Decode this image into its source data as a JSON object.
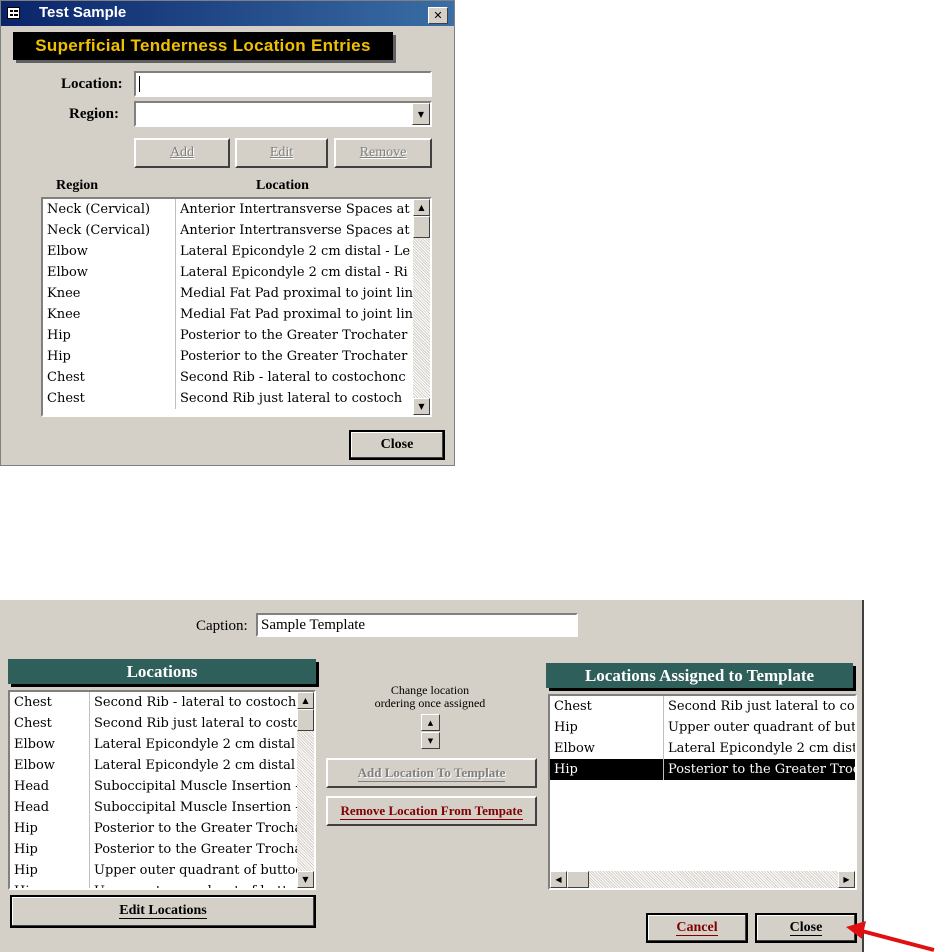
{
  "window1": {
    "title": "Test Sample",
    "title_icon": "form-icon",
    "close_glyph": "✕",
    "header": "Superficial Tenderness Location Entries",
    "location_label": "Location:",
    "location_value": "",
    "region_label": "Region:",
    "region_value": "",
    "add_label": "Add",
    "edit_label": "Edit",
    "remove_label": "Remove",
    "col_region": "Region",
    "col_location": "Location",
    "rows": [
      {
        "region": "Neck (Cervical)",
        "location": "Anterior Intertransverse Spaces at"
      },
      {
        "region": "Neck (Cervical)",
        "location": "Anterior Intertransverse Spaces at"
      },
      {
        "region": "Elbow",
        "location": "Lateral Epicondyle 2 cm distal - Le"
      },
      {
        "region": "Elbow",
        "location": "Lateral Epicondyle 2 cm distal - Ri"
      },
      {
        "region": "Knee",
        "location": "Medial Fat Pad proximal to joint lin"
      },
      {
        "region": "Knee",
        "location": "Medial Fat Pad proximal to joint lin"
      },
      {
        "region": "Hip",
        "location": "Posterior to the Greater Trochater"
      },
      {
        "region": "Hip",
        "location": "Posterior to the Greater Trochater"
      },
      {
        "region": "Chest",
        "location": "Second Rib - lateral to costochonc"
      },
      {
        "region": "Chest",
        "location": "Second Rib just lateral to costoch"
      }
    ],
    "close_label": "Close"
  },
  "window2": {
    "caption_label": "Caption:",
    "caption_value": "Sample Template",
    "locations_header": "Locations",
    "locations_rows": [
      {
        "region": "Chest",
        "location": "Second Rib - lateral to costochc"
      },
      {
        "region": "Chest",
        "location": "Second Rib just lateral to costo"
      },
      {
        "region": "Elbow",
        "location": "Lateral Epicondyle 2 cm distal -"
      },
      {
        "region": "Elbow",
        "location": "Lateral Epicondyle 2 cm distal -"
      },
      {
        "region": "Head",
        "location": "Suboccipital Muscle Insertion -"
      },
      {
        "region": "Head",
        "location": "Suboccipital Muscle Insertion -"
      },
      {
        "region": "Hip",
        "location": "Posterior to the Greater Trochat"
      },
      {
        "region": "Hip",
        "location": "Posterior to the Greater Trochat"
      },
      {
        "region": "Hip",
        "location": "Upper outer quadrant of buttoc"
      },
      {
        "region": "Hip",
        "location": "Upper outer quadrant of buttoc"
      }
    ],
    "edit_locations_label": "Edit Locations",
    "change_order_text_1": "Change location",
    "change_order_text_2": "ordering once assigned",
    "add_to_template_label": "Add Location To Template",
    "remove_from_template_label": "Remove Location From Tempate",
    "assigned_header": "Locations Assigned to Template",
    "assigned_rows": [
      {
        "region": "Chest",
        "location": "Second Rib just lateral to cos"
      },
      {
        "region": "Hip",
        "location": "Upper outer quadrant of butt"
      },
      {
        "region": "Elbow",
        "location": "Lateral Epicondyle 2 cm dista"
      },
      {
        "region": "Hip",
        "location": "Posterior to the Greater Troch"
      }
    ],
    "cancel_label": "Cancel",
    "close_label": "Close"
  },
  "colors": {
    "dialog_bg": "#d4d0c8",
    "titlebar": "#0a246a",
    "header_bg": "#2f5f5a",
    "header1_text": "#f0c000",
    "arrow": "#e01010"
  }
}
